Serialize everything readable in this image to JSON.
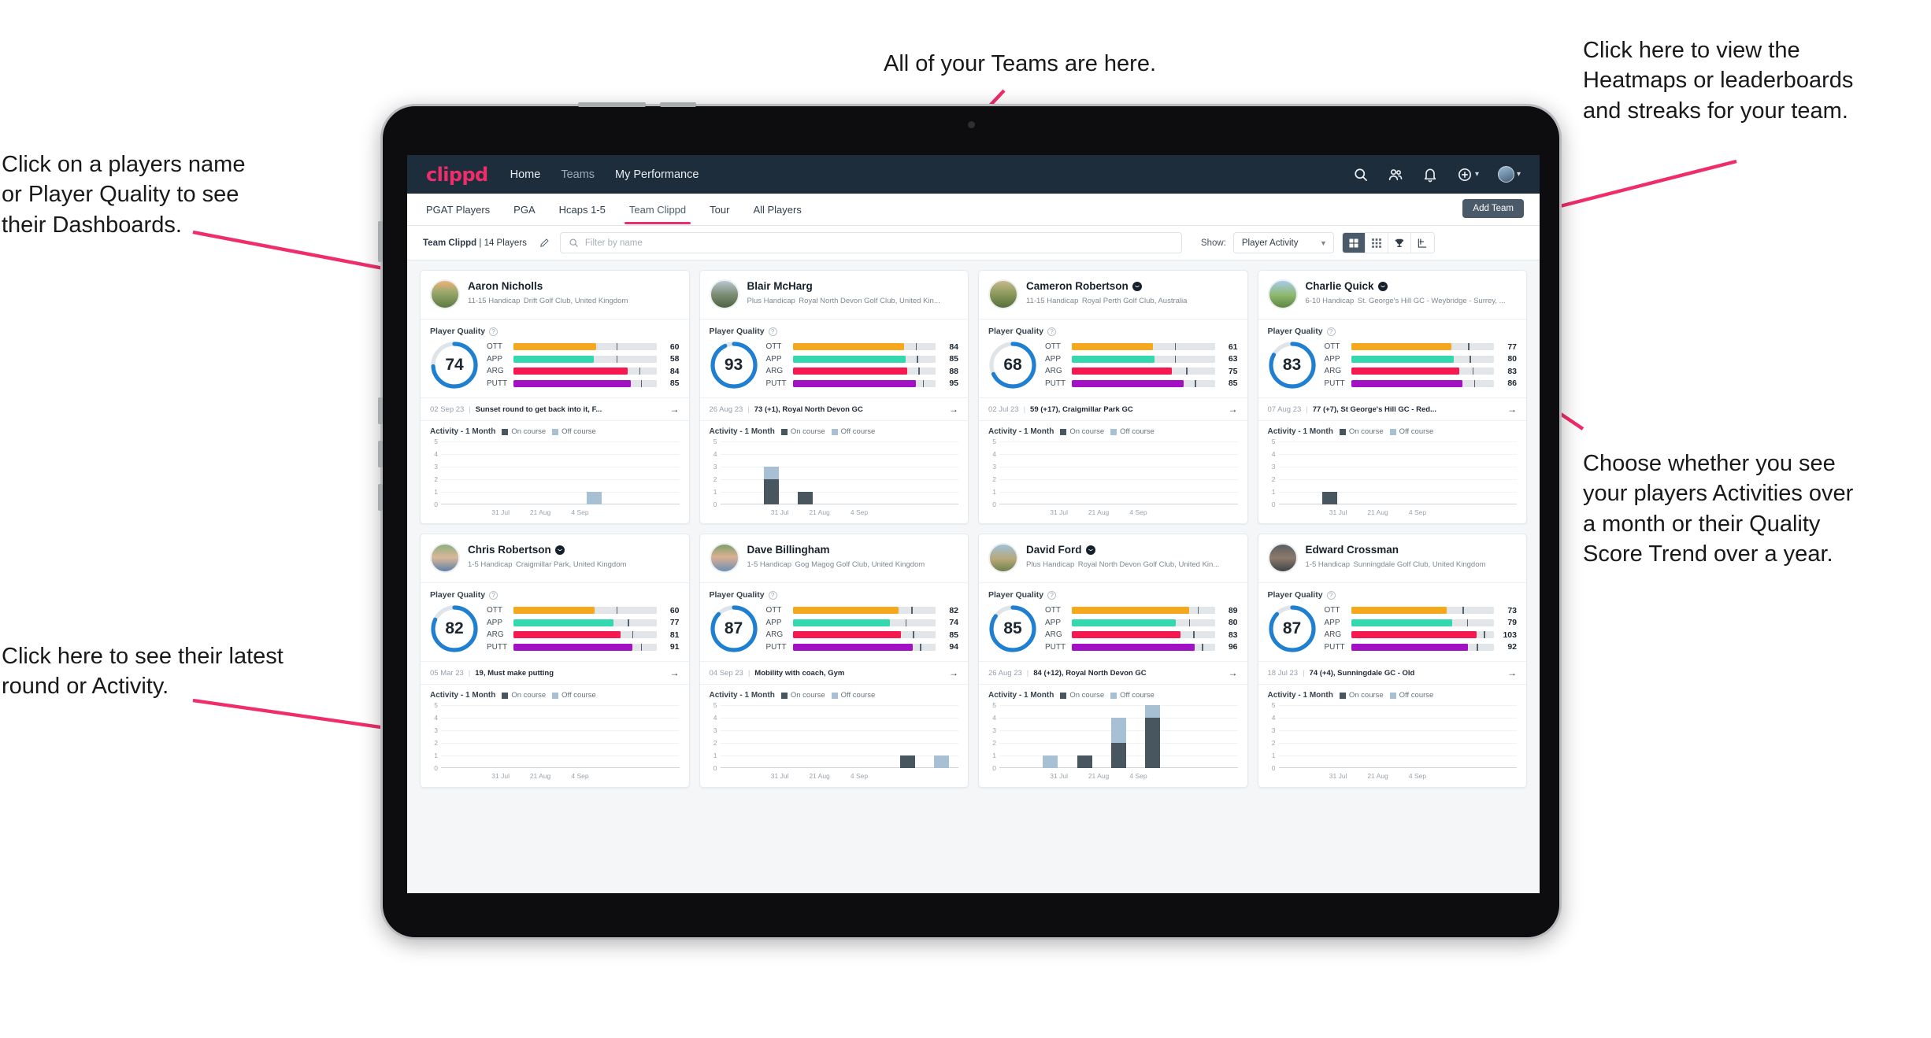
{
  "annotations": {
    "top_left": "Click on a players name\nor Player Quality to see\ntheir Dashboards.",
    "bottom_left": "Click here to see their latest\nround or Activity.",
    "top_center": "All of your Teams are here.",
    "top_right": "Click here to view the\nHeatmaps or leaderboards\nand streaks for your team.",
    "middle_right": "Choose whether you see\nyour players Activities over\na month or their Quality\nScore Trend over a year."
  },
  "topnav": {
    "brand": "clippd",
    "links": [
      {
        "label": "Home",
        "active": true
      },
      {
        "label": "Teams",
        "active": false
      },
      {
        "label": "My Performance",
        "active": true
      }
    ],
    "icons": [
      "search-icon",
      "people-icon",
      "bell-icon",
      "plus-circle-icon",
      "avatar"
    ]
  },
  "tabs": [
    {
      "label": "PGAT Players",
      "active": false
    },
    {
      "label": "PGA",
      "active": false
    },
    {
      "label": "Hcaps 1-5",
      "active": false
    },
    {
      "label": "Team Clippd",
      "active": true
    },
    {
      "label": "Tour",
      "active": false
    },
    {
      "label": "All Players",
      "active": false
    }
  ],
  "add_team_label": "Add Team",
  "filterbar": {
    "team_name": "Team Clippd",
    "team_count": "14 Players",
    "separator": "|",
    "edit_icon": "pencil-icon",
    "search_placeholder": "Filter by name",
    "search_value": "",
    "show_label": "Show:",
    "show_value": "Player Activity",
    "show_options": [
      "Player Activity",
      "Quality Score Trend"
    ],
    "views": [
      {
        "name": "grid-large-view",
        "active": true
      },
      {
        "name": "grid-small-view",
        "active": false
      },
      {
        "name": "trophy-leaderboard-view",
        "active": false
      },
      {
        "name": "heatmap-view",
        "active": false
      }
    ]
  },
  "card_labels": {
    "player_quality": "Player Quality",
    "activity": "Activity - 1 Month",
    "legend_on": "On course",
    "legend_off": "Off course",
    "help_icon": "question-circle-icon",
    "arrow_icon": "arrow-right-icon"
  },
  "colors": {
    "brand_pink": "#ef2d6a",
    "navbar": "#1e2d3b",
    "ring": "#1f7fd0",
    "ott": "#f5a81c",
    "app": "#34d8ae",
    "arg": "#f5194f",
    "putt": "#a211c4",
    "on_course": "#47565f",
    "off_course": "#a8c0d4"
  },
  "chart_data": {
    "type": "bar",
    "title": "Activity - 1 Month",
    "ylabel": "",
    "xlabel": "",
    "ylim": [
      0,
      5
    ],
    "yticks": [
      0,
      1,
      2,
      3,
      4,
      5
    ],
    "xticks": [
      "31 Jul",
      "21 Aug",
      "4 Sep"
    ],
    "stacked": true,
    "legend": [
      "On course",
      "Off course"
    ],
    "legend_position": "top",
    "grid": true,
    "slots": 7
  },
  "players": [
    {
      "name": "Aaron Nicholls",
      "verified": false,
      "handicap": "11-15 Handicap",
      "club": "Drift Golf Club, United Kingdom",
      "avatar_hint": "golf-course-sunset",
      "quality": 74,
      "skills": [
        {
          "key": "OTT",
          "value": 60,
          "fill": 58,
          "tick": 72
        },
        {
          "key": "APP",
          "value": 58,
          "fill": 56,
          "tick": 72
        },
        {
          "key": "ARG",
          "value": 84,
          "fill": 80,
          "tick": 88
        },
        {
          "key": "PUTT",
          "value": 85,
          "fill": 82,
          "tick": 89
        }
      ],
      "round_date": "02 Sep 23",
      "round_text": "Sunset round to get back into it, F...",
      "activity": {
        "on": [
          0,
          0,
          0,
          0,
          0,
          0,
          0
        ],
        "off": [
          0,
          0,
          0,
          0,
          1,
          0,
          0
        ]
      }
    },
    {
      "name": "Blair McHarg",
      "verified": false,
      "handicap": "Plus Handicap",
      "club": "Royal North Devon Golf Club, United Kin...",
      "avatar_hint": "golfer-on-links",
      "quality": 93,
      "skills": [
        {
          "key": "OTT",
          "value": 84,
          "fill": 78,
          "tick": 86
        },
        {
          "key": "APP",
          "value": 85,
          "fill": 79,
          "tick": 87
        },
        {
          "key": "ARG",
          "value": 88,
          "fill": 80,
          "tick": 88
        },
        {
          "key": "PUTT",
          "value": 95,
          "fill": 86,
          "tick": 91
        }
      ],
      "round_date": "26 Aug 23",
      "round_text": "73 (+1), Royal North Devon GC",
      "activity": {
        "on": [
          0,
          2,
          1,
          0,
          0,
          0,
          0
        ],
        "off": [
          0,
          1,
          0,
          0,
          0,
          0,
          0
        ],
        "on2": [
          0,
          0,
          0,
          0,
          0,
          0,
          0
        ]
      }
    },
    {
      "name": "Cameron Robertson",
      "verified": true,
      "handicap": "11-15 Handicap",
      "club": "Royal Perth Golf Club, Australia",
      "avatar_hint": "golfer-in-rough",
      "quality": 68,
      "skills": [
        {
          "key": "OTT",
          "value": 61,
          "fill": 57,
          "tick": 72
        },
        {
          "key": "APP",
          "value": 63,
          "fill": 58,
          "tick": 72
        },
        {
          "key": "ARG",
          "value": 75,
          "fill": 70,
          "tick": 80
        },
        {
          "key": "PUTT",
          "value": 85,
          "fill": 78,
          "tick": 86
        }
      ],
      "round_date": "02 Jul 23",
      "round_text": "59 (+17), Craigmillar Park GC",
      "activity": {
        "on": [
          0,
          0,
          0,
          0,
          0,
          0,
          0
        ],
        "off": [
          0,
          0,
          0,
          0,
          0,
          0,
          0
        ]
      }
    },
    {
      "name": "Charlie Quick",
      "verified": true,
      "handicap": "6-10 Handicap",
      "club": "St. George's Hill GC - Weybridge - Surrey, ...",
      "avatar_hint": "golf-green-sky",
      "quality": 83,
      "skills": [
        {
          "key": "OTT",
          "value": 77,
          "fill": 70,
          "tick": 82
        },
        {
          "key": "APP",
          "value": 80,
          "fill": 72,
          "tick": 83
        },
        {
          "key": "ARG",
          "value": 83,
          "fill": 76,
          "tick": 85
        },
        {
          "key": "PUTT",
          "value": 86,
          "fill": 78,
          "tick": 86
        }
      ],
      "round_date": "07 Aug 23",
      "round_text": "77 (+7), St George's Hill GC - Red...",
      "activity": {
        "on": [
          0,
          1,
          0,
          0,
          0,
          0,
          0
        ],
        "off": [
          0,
          0,
          0,
          0,
          0,
          0,
          0
        ]
      }
    },
    {
      "name": "Chris Robertson",
      "verified": true,
      "handicap": "1-5 Handicap",
      "club": "Craigmillar Park, United Kingdom",
      "avatar_hint": "man-portrait-glasses",
      "quality": 82,
      "skills": [
        {
          "key": "OTT",
          "value": 60,
          "fill": 57,
          "tick": 72
        },
        {
          "key": "APP",
          "value": 77,
          "fill": 70,
          "tick": 80
        },
        {
          "key": "ARG",
          "value": 81,
          "fill": 75,
          "tick": 83
        },
        {
          "key": "PUTT",
          "value": 91,
          "fill": 83,
          "tick": 89
        }
      ],
      "round_date": "05 Mar 23",
      "round_text": "19, Must make putting",
      "activity": {
        "on": [
          0,
          0,
          0,
          0,
          0,
          0,
          0
        ],
        "off": [
          0,
          0,
          0,
          0,
          0,
          0,
          0
        ]
      }
    },
    {
      "name": "Dave Billingham",
      "verified": false,
      "handicap": "1-5 Handicap",
      "club": "Gog Magog Golf Club, United Kingdom",
      "avatar_hint": "man-portrait-beard",
      "quality": 87,
      "skills": [
        {
          "key": "OTT",
          "value": 82,
          "fill": 74,
          "tick": 83
        },
        {
          "key": "APP",
          "value": 74,
          "fill": 68,
          "tick": 79
        },
        {
          "key": "ARG",
          "value": 85,
          "fill": 76,
          "tick": 84
        },
        {
          "key": "PUTT",
          "value": 94,
          "fill": 84,
          "tick": 89
        }
      ],
      "round_date": "04 Sep 23",
      "round_text": "Mobility with coach, Gym",
      "activity": {
        "on": [
          0,
          0,
          0,
          0,
          0,
          1,
          0
        ],
        "off": [
          0,
          0,
          0,
          0,
          0,
          0,
          1
        ]
      }
    },
    {
      "name": "David Ford",
      "verified": true,
      "handicap": "Plus Handicap",
      "club": "Royal North Devon Golf Club, United Kin...",
      "avatar_hint": "golfer-walking",
      "quality": 85,
      "skills": [
        {
          "key": "OTT",
          "value": 89,
          "fill": 82,
          "tick": 88
        },
        {
          "key": "APP",
          "value": 80,
          "fill": 73,
          "tick": 82
        },
        {
          "key": "ARG",
          "value": 83,
          "fill": 76,
          "tick": 85
        },
        {
          "key": "PUTT",
          "value": 96,
          "fill": 86,
          "tick": 91
        }
      ],
      "round_date": "26 Aug 23",
      "round_text": "84 (+12), Royal North Devon GC",
      "activity": {
        "on": [
          0,
          0,
          1,
          2,
          4,
          0,
          0
        ],
        "off": [
          0,
          1,
          0,
          2,
          1,
          0,
          0
        ]
      }
    },
    {
      "name": "Edward Crossman",
      "verified": false,
      "handicap": "1-5 Handicap",
      "club": "Sunningdale Golf Club, United Kingdom",
      "avatar_hint": "person-indoor",
      "quality": 87,
      "skills": [
        {
          "key": "OTT",
          "value": 73,
          "fill": 67,
          "tick": 78
        },
        {
          "key": "APP",
          "value": 79,
          "fill": 71,
          "tick": 81
        },
        {
          "key": "ARG",
          "value": 103,
          "fill": 88,
          "tick": 93
        },
        {
          "key": "PUTT",
          "value": 92,
          "fill": 82,
          "tick": 88
        }
      ],
      "round_date": "18 Jul 23",
      "round_text": "74 (+4), Sunningdale GC - Old",
      "activity": {
        "on": [
          0,
          0,
          0,
          0,
          0,
          0,
          0
        ],
        "off": [
          0,
          0,
          0,
          0,
          0,
          0,
          0
        ]
      }
    }
  ]
}
